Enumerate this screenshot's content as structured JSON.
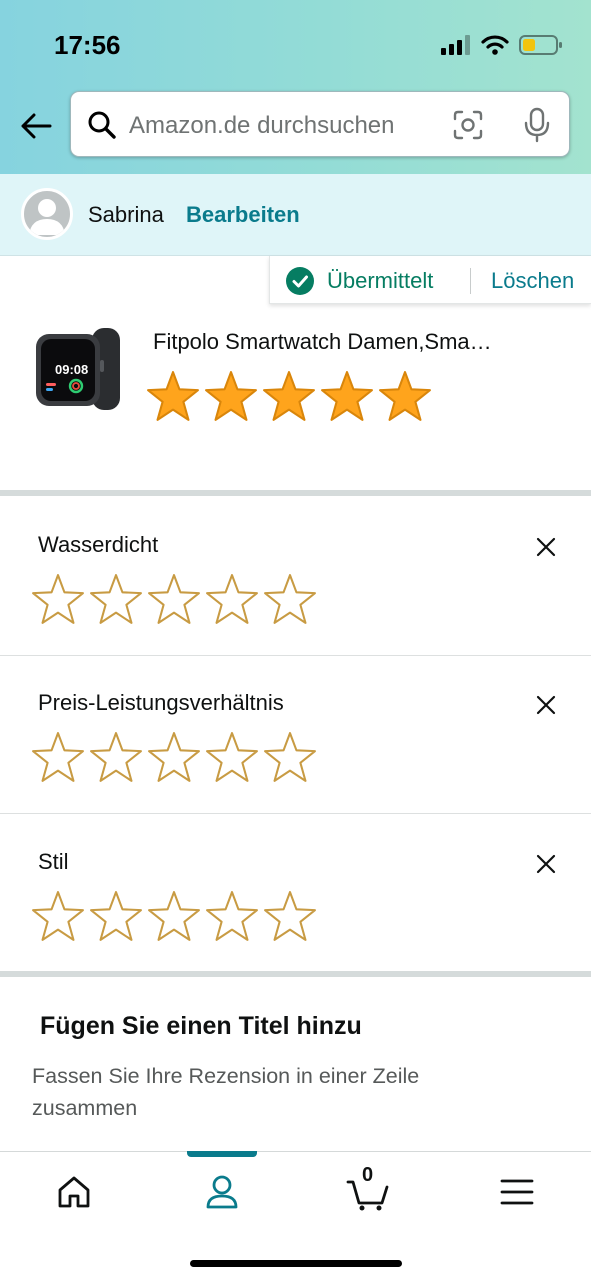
{
  "status_bar": {
    "time": "17:56"
  },
  "search": {
    "placeholder": "Amazon.de durchsuchen"
  },
  "user": {
    "name": "Sabrina",
    "edit_label": "Bearbeiten"
  },
  "review_status": {
    "status": "Übermittelt",
    "delete_label": "Löschen"
  },
  "product": {
    "title": "Fitpolo Smartwatch Damen,Sma…",
    "watch_time": "09:08",
    "rating": 5,
    "max_rating": 5
  },
  "criteria": [
    {
      "label": "Wasserdicht",
      "rating": 0
    },
    {
      "label": "Preis-Leistungsverhältnis",
      "rating": 0
    },
    {
      "label": "Stil",
      "rating": 0
    }
  ],
  "title_section": {
    "heading": "Fügen Sie einen Titel hinzu",
    "subtext": "Fassen Sie Ihre Rezension in einer Zeile zusammen"
  },
  "bottom_nav": {
    "cart_count": "0",
    "active": "profile"
  },
  "colors": {
    "accent": "#0a7b8c",
    "success": "#067d62",
    "star_fill": "#ffa41c",
    "star_outline": "#c89b43"
  }
}
